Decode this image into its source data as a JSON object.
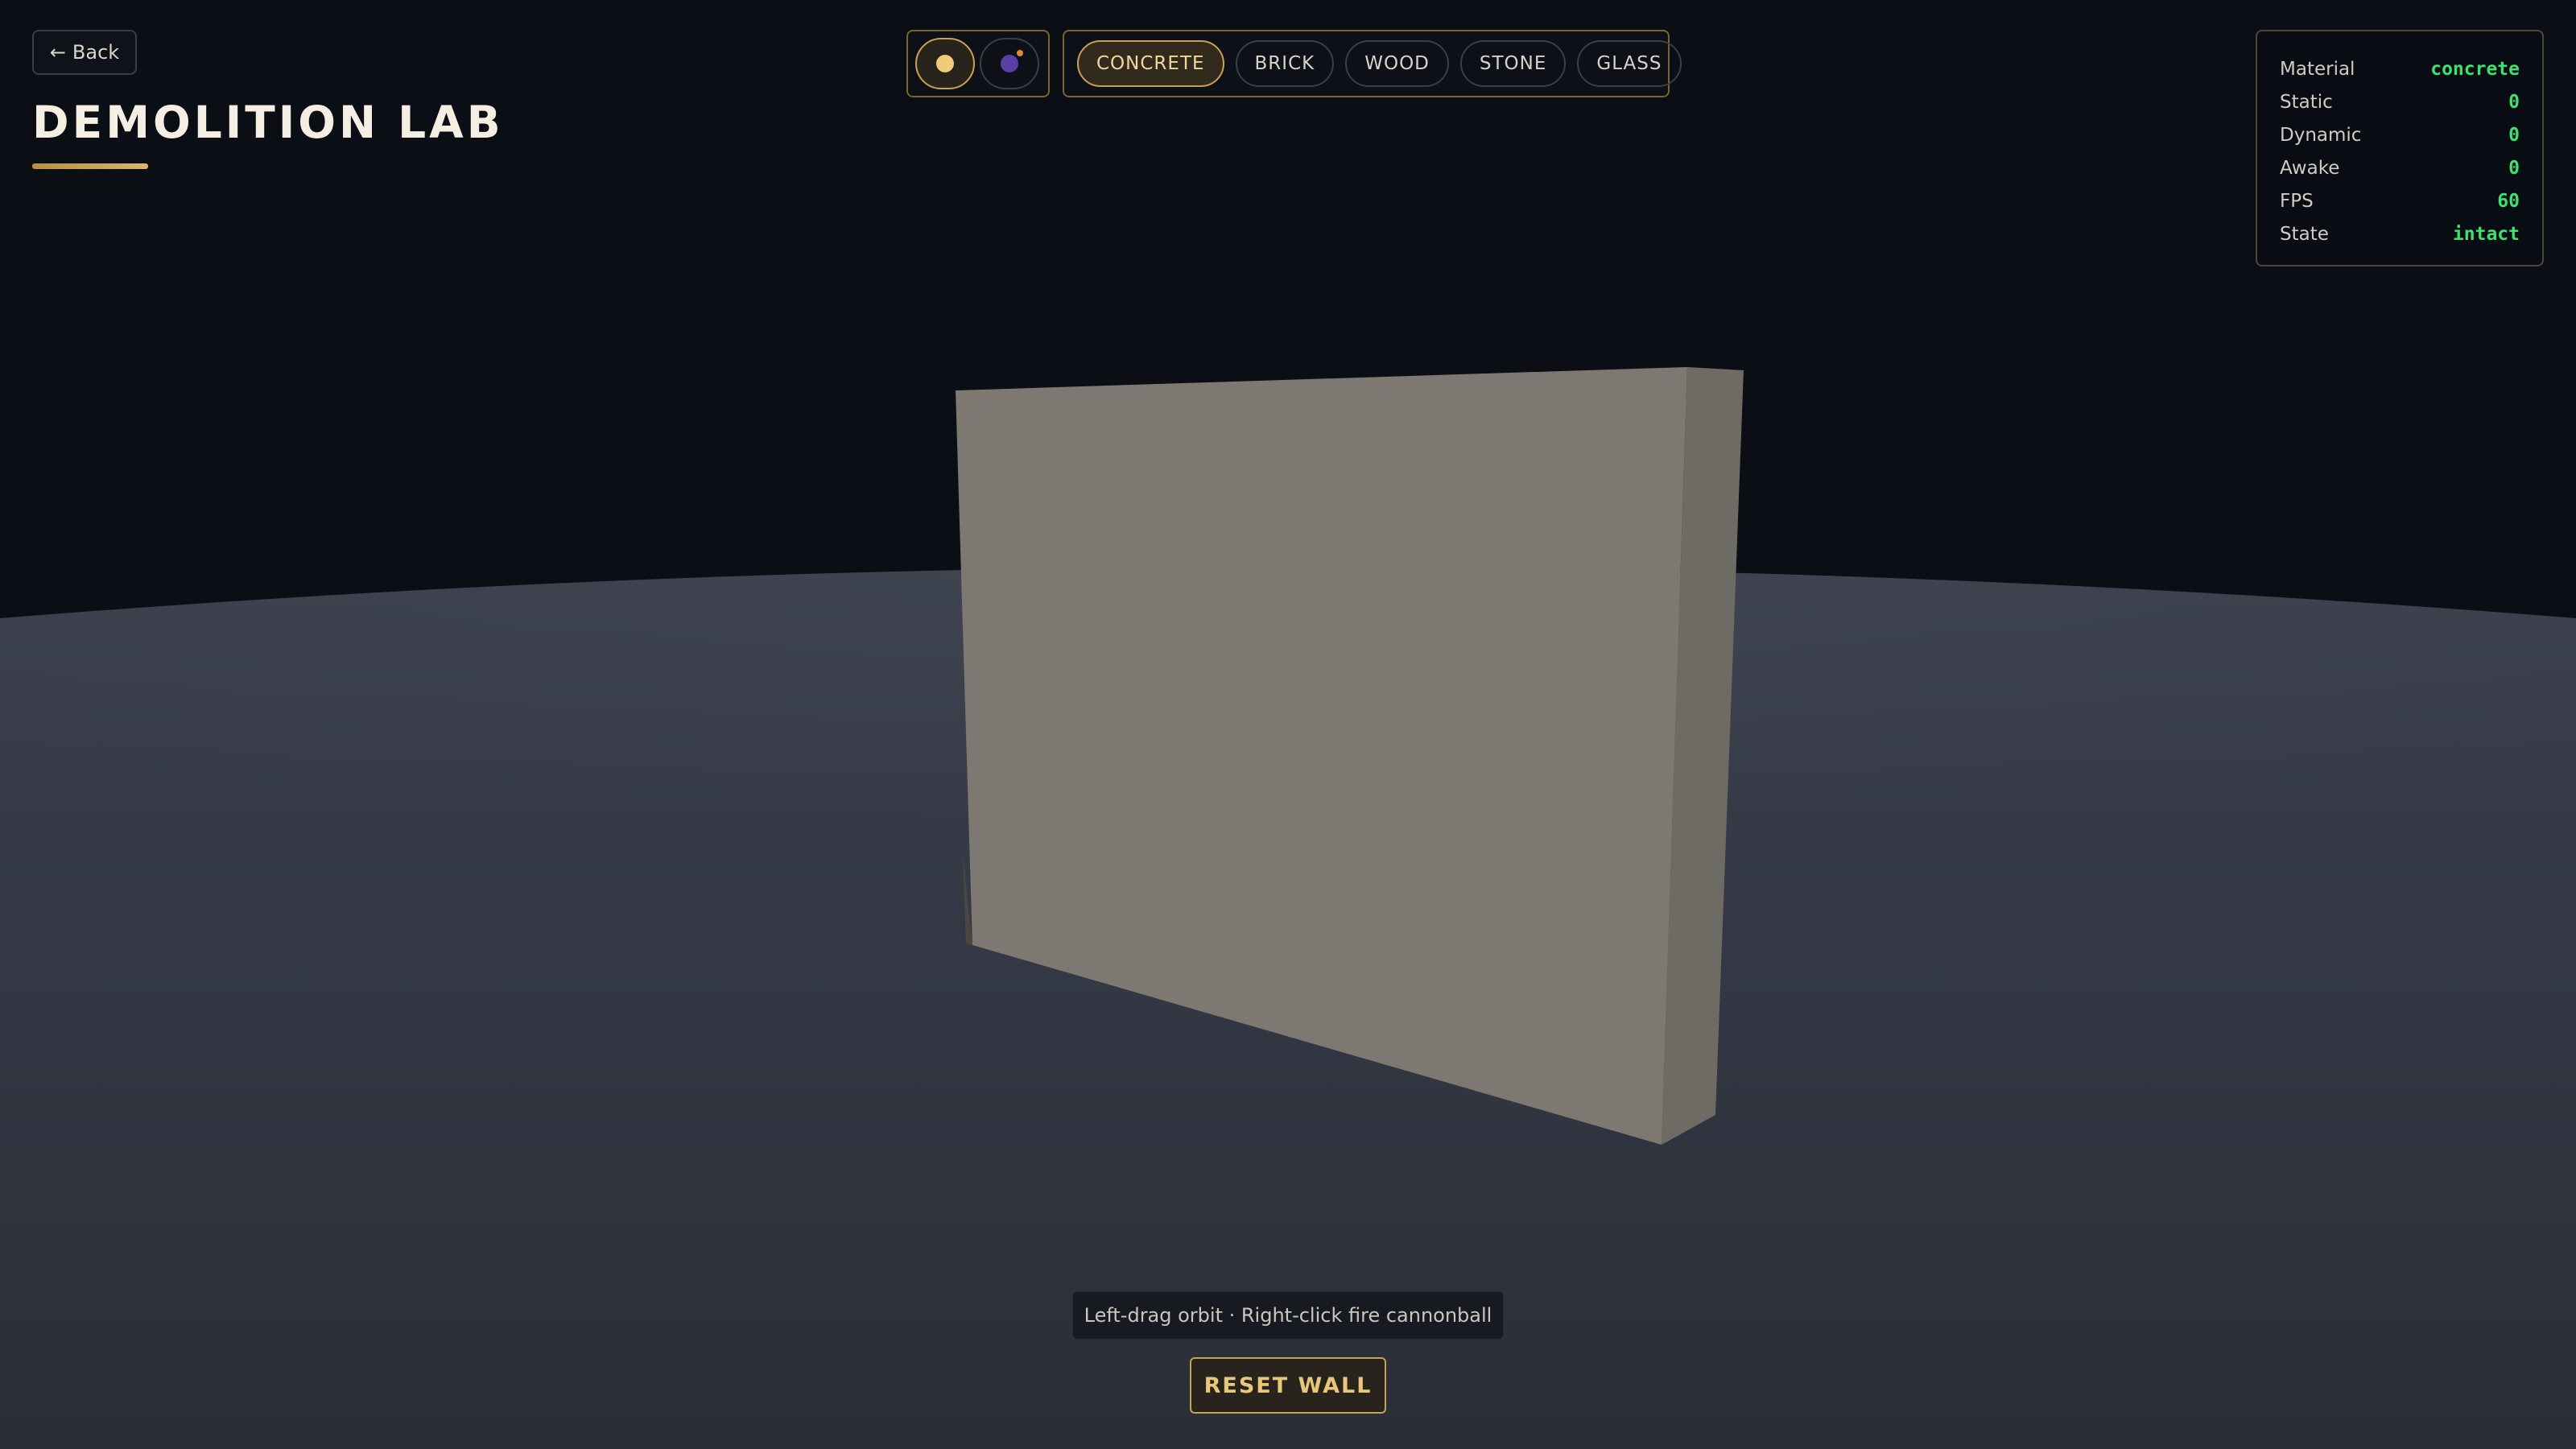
{
  "header": {
    "back_label": "Back",
    "back_icon": "left-arrow-icon",
    "title": "DEMOLITION LAB"
  },
  "ammo": {
    "items": [
      {
        "icon": "cannonball-icon",
        "active": true
      },
      {
        "icon": "bomb-icon",
        "active": false
      }
    ]
  },
  "materials": {
    "items": [
      {
        "label": "CONCRETE",
        "active": true
      },
      {
        "label": "BRICK",
        "active": false
      },
      {
        "label": "WOOD",
        "active": false
      },
      {
        "label": "STONE",
        "active": false
      },
      {
        "label": "GLASS",
        "active": false
      }
    ]
  },
  "stats": {
    "rows": [
      {
        "label": "Material",
        "value": "concrete"
      },
      {
        "label": "Static",
        "value": "0"
      },
      {
        "label": "Dynamic",
        "value": "0"
      },
      {
        "label": "Awake",
        "value": "0"
      },
      {
        "label": "FPS",
        "value": "60"
      },
      {
        "label": "State",
        "value": "intact"
      }
    ]
  },
  "hint": "Left-drag orbit · Right-click fire cannonball",
  "reset_label": "RESET WALL",
  "colors": {
    "accent": "#c9a154",
    "stat_value": "#3ee06f",
    "wall_face": "#7d7871",
    "wall_side": "#6e6a64",
    "sky": "#0b0e15",
    "ground": "#343945"
  }
}
